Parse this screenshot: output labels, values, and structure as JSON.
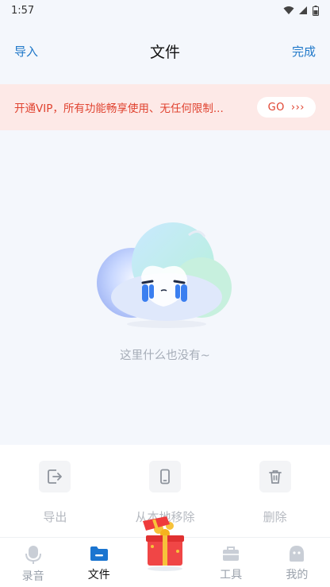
{
  "status": {
    "time": "1:57"
  },
  "nav": {
    "import_label": "导入",
    "title": "文件",
    "done_label": "完成"
  },
  "banner": {
    "text": "开通VIP，所有功能畅享使用、无任何限制...",
    "go_label": "GO",
    "go_arrows": "›››",
    "colors": {
      "background": "#fde9e7",
      "text": "#e0422f"
    }
  },
  "empty_state": {
    "message": "这里什么也没有~"
  },
  "actions": [
    {
      "label": "导出",
      "icon": "export-icon"
    },
    {
      "label": "从本地移除",
      "icon": "phone-remove-icon"
    },
    {
      "label": "删除",
      "icon": "trash-icon"
    }
  ],
  "tabs": [
    {
      "label": "录音",
      "icon": "microphone-icon",
      "active": false
    },
    {
      "label": "文件",
      "icon": "folder-icon",
      "active": true
    },
    {
      "label": "工具",
      "icon": "toolbox-icon",
      "active": false
    },
    {
      "label": "我的",
      "icon": "profile-icon",
      "active": false
    }
  ],
  "colors": {
    "accent": "#1f78c9",
    "active_folder": "#1b75d0"
  }
}
